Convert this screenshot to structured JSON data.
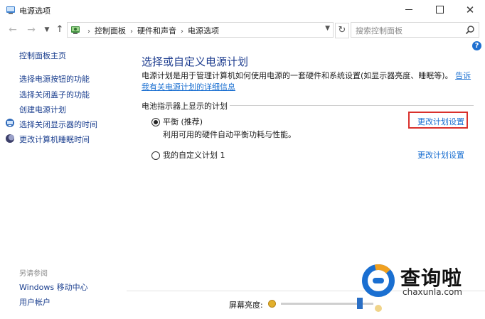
{
  "window": {
    "title": "电源选项",
    "minimize": "—",
    "maximize": "□",
    "close": "✕"
  },
  "address_bar": {
    "breadcrumbs": [
      "控制面板",
      "硬件和声音",
      "电源选项"
    ],
    "search_placeholder": "搜索控制面板"
  },
  "sidebar": {
    "home": "控制面板主页",
    "items": [
      {
        "label": "选择电源按钮的功能",
        "icon": null
      },
      {
        "label": "选择关闭盖子的功能",
        "icon": null
      },
      {
        "label": "创建电源计划",
        "icon": null
      },
      {
        "label": "选择关闭显示器的时间",
        "icon": "monitor-icon"
      },
      {
        "label": "更改计算机睡眠时间",
        "icon": "moon-icon"
      }
    ],
    "see_also_label": "另请参阅",
    "see_also": [
      "Windows 移动中心",
      "用户帐户"
    ]
  },
  "main": {
    "title": "选择或自定义电源计划",
    "description": "电源计划是用于管理计算机如何使用电源的一套硬件和系统设置(如显示器亮度、睡眠等)。",
    "description_link": "告诉我有关电源计划的详细信息",
    "section_header": "电池指示器上显示的计划",
    "plans": [
      {
        "name": "平衡 (推荐)",
        "description": "利用可用的硬件自动平衡功耗与性能。",
        "selected": true,
        "change_link": "更改计划设置"
      },
      {
        "name": "我的自定义计划 1",
        "description": "",
        "selected": false,
        "change_link": "更改计划设置"
      }
    ]
  },
  "footer": {
    "brightness_label": "屏幕亮度:",
    "brightness_level_fraction": 0.85
  },
  "watermark": {
    "brand": "查询啦",
    "url": "chaxunla.com",
    "colors": {
      "circle": "#1a6fd1",
      "accent": "#f0a020"
    }
  },
  "colors": {
    "link": "#1a6fd1",
    "heading": "#1e3d8f",
    "highlight_border": "#d9302b"
  }
}
